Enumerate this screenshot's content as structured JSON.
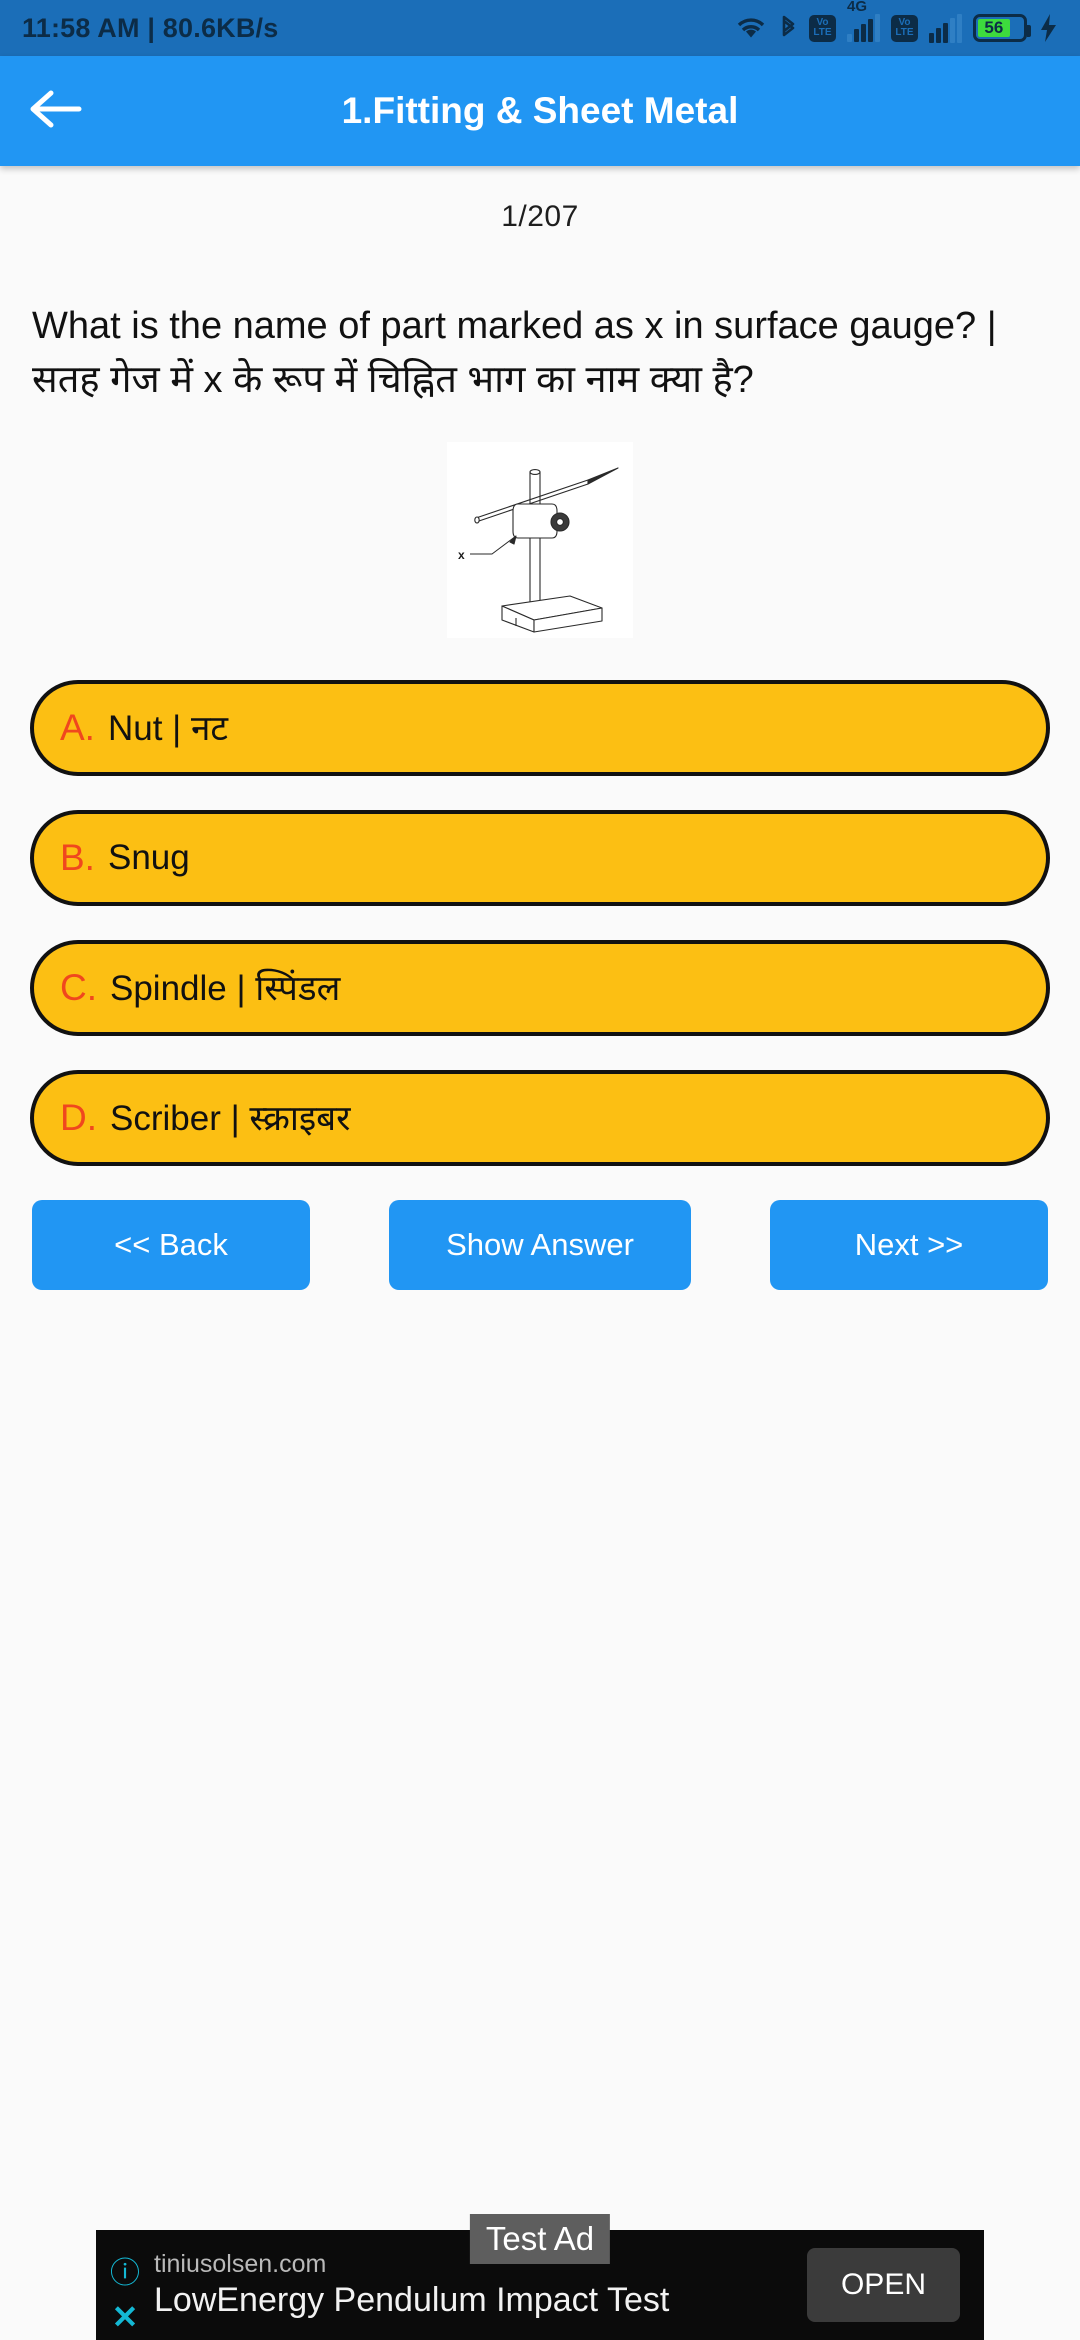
{
  "statusbar": {
    "time_and_speed": "11:58 AM | 80.6KB/s",
    "wifi_icon": "wifi-icon",
    "bluetooth_icon": "bluetooth-icon",
    "volte_top": "Vo",
    "volte_bottom": "LTE",
    "network_type": "4G",
    "battery_level": "56",
    "charging_icon": "charging-bolt-icon"
  },
  "appbar": {
    "back_icon": "back-arrow-icon",
    "title": "1.Fitting & Sheet Metal"
  },
  "quiz": {
    "counter": "1/207",
    "question": "What is the name of part marked as x in surface gauge? | सतह गेज में x के रूप में चिह्नित भाग का नाम क्या है?",
    "figure_label": "x",
    "figure_alt": "surface-gauge-diagram",
    "options": [
      {
        "letter": "A.",
        "text": "Nut | नट"
      },
      {
        "letter": "B.",
        "text": "Snug"
      },
      {
        "letter": "C.",
        "text": "Spindle | स्पिंडल"
      },
      {
        "letter": "D.",
        "text": "Scriber | स्क्राइबर"
      }
    ]
  },
  "nav": {
    "back": "<< Back",
    "show_answer": "Show Answer",
    "next": "Next >>"
  },
  "ad": {
    "test_label": "Test Ad",
    "domain": "tiniusolsen.com",
    "headline": "LowEnergy Pendulum Impact Test",
    "open_button": "OPEN",
    "info_icon": "ⓘ",
    "close_icon": "✕"
  },
  "colors": {
    "statusbar": "#1B6EB8",
    "appbar": "#2196F3",
    "option": "#FCBF13",
    "option_letter": "#F0471E",
    "nav_button": "#2196F3",
    "battery_fill": "#3DDB3D",
    "ad_background": "#0B0B0B",
    "ad_accent": "#14B8D4"
  }
}
